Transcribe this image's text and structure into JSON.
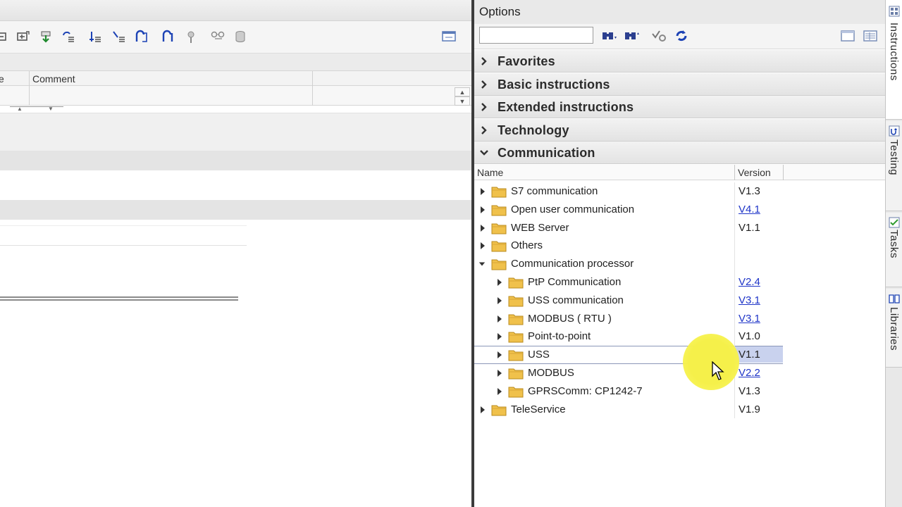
{
  "editor": {
    "columns": {
      "first_partial": "e",
      "comment": "Comment"
    },
    "toolbar_icons": [
      "network-icon",
      "insert-network-icon",
      "download-icon",
      "insert-row-icon",
      "align-left-icon",
      "branch-icon",
      "open-branch-icon",
      "close-branch-icon",
      "key-icon",
      "glasses-icon",
      "database-icon"
    ]
  },
  "options": {
    "title": "Options",
    "search": {
      "value": "",
      "placeholder": ""
    },
    "palettes": [
      {
        "label": "Favorites",
        "expanded": false
      },
      {
        "label": "Basic instructions",
        "expanded": false
      },
      {
        "label": "Extended instructions",
        "expanded": false
      },
      {
        "label": "Technology",
        "expanded": false
      },
      {
        "label": "Communication",
        "expanded": true
      }
    ],
    "tree_columns": {
      "name": "Name",
      "version": "Version"
    },
    "tree": [
      {
        "name": "S7 communication",
        "version": "V1.3",
        "link": false,
        "level": 0,
        "expanded": false
      },
      {
        "name": "Open user communication",
        "version": "V4.1",
        "link": true,
        "level": 0,
        "expanded": false
      },
      {
        "name": "WEB Server",
        "version": "V1.1",
        "link": false,
        "level": 0,
        "expanded": false
      },
      {
        "name": "Others",
        "version": "",
        "link": false,
        "level": 0,
        "expanded": false
      },
      {
        "name": "Communication processor",
        "version": "",
        "link": false,
        "level": 0,
        "expanded": true
      },
      {
        "name": "PtP Communication",
        "version": "V2.4",
        "link": true,
        "level": 1,
        "expanded": false
      },
      {
        "name": "USS communication",
        "version": "V3.1",
        "link": true,
        "level": 1,
        "expanded": false
      },
      {
        "name": "MODBUS ( RTU )",
        "version": "V3.1",
        "link": true,
        "level": 1,
        "expanded": false
      },
      {
        "name": "Point-to-point",
        "version": "V1.0",
        "link": false,
        "level": 1,
        "expanded": false
      },
      {
        "name": "USS",
        "version": "V1.1",
        "link": false,
        "level": 1,
        "expanded": false,
        "selected": true
      },
      {
        "name": "MODBUS",
        "version": "V2.2",
        "link": true,
        "level": 1,
        "expanded": false
      },
      {
        "name": "GPRSComm: CP1242-7",
        "version": "V1.3",
        "link": false,
        "level": 1,
        "expanded": false
      },
      {
        "name": "TeleService",
        "version": "V1.9",
        "link": false,
        "level": 0,
        "expanded": false
      }
    ]
  },
  "side_tabs": [
    {
      "label": "Instructions",
      "icon": "instructions-icon",
      "active": true
    },
    {
      "label": "Testing",
      "icon": "testing-icon",
      "active": false
    },
    {
      "label": "Tasks",
      "icon": "tasks-icon",
      "active": false
    },
    {
      "label": "Libraries",
      "icon": "libraries-icon",
      "active": false
    }
  ],
  "colors": {
    "link": "#1f35c8",
    "selection": "#c9d2ee",
    "highlight": "#f5f04a",
    "folder": "#f0c14b"
  }
}
